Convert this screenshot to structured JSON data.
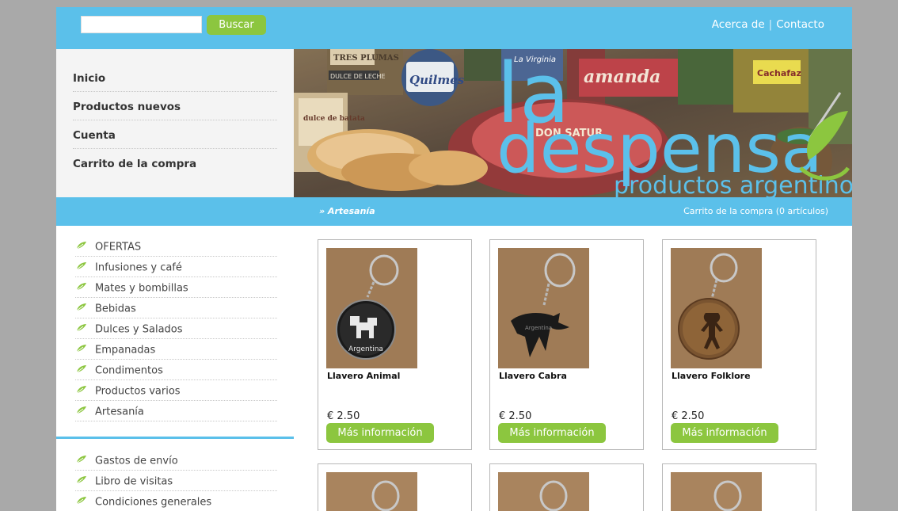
{
  "header": {
    "search": {
      "value": "",
      "placeholder": "",
      "button_label": "Buscar"
    },
    "links": [
      {
        "label": "Acerca de"
      },
      {
        "label": "Contacto"
      }
    ],
    "separator": "|"
  },
  "main_nav": {
    "items": [
      {
        "label": "Inicio"
      },
      {
        "label": "Productos nuevos"
      },
      {
        "label": "Cuenta"
      },
      {
        "label": "Carrito de la compra"
      }
    ]
  },
  "banner": {
    "logo_line1": "la",
    "logo_line2": "despensa",
    "logo_tagline": "productos argentinos",
    "package_texts": [
      "TRES PLUMAS",
      "DULCE DE LECHE",
      "Quilmes",
      "La Virginia",
      "amanda",
      "DON SATUR",
      "dulce de batata",
      "Cachafaz"
    ]
  },
  "subbar": {
    "breadcrumb": "» Artesanía",
    "cart_status": "Carrito de la compra (0 artículos)"
  },
  "sidebar": {
    "categories": [
      {
        "label": "OFERTAS"
      },
      {
        "label": "Infusiones y café"
      },
      {
        "label": "Mates y bombillas"
      },
      {
        "label": "Bebidas"
      },
      {
        "label": "Dulces y Salados"
      },
      {
        "label": "Empanadas"
      },
      {
        "label": "Condimentos"
      },
      {
        "label": "Productos varios"
      },
      {
        "label": "Artesanía"
      }
    ],
    "info_links": [
      {
        "label": "Gastos de envío"
      },
      {
        "label": "Libro de visitas"
      },
      {
        "label": "Condiciones generales"
      }
    ]
  },
  "products": [
    {
      "name": "Llavero Animal",
      "price": "€ 2.50",
      "button_label": "Más información",
      "tag_text": "Argentina"
    },
    {
      "name": "Llavero Cabra",
      "price": "€ 2.50",
      "button_label": "Más información",
      "tag_text": "Argentina"
    },
    {
      "name": "Llavero Folklore",
      "price": "€ 2.50",
      "button_label": "Más información"
    }
  ],
  "colors": {
    "accent_blue": "#5bc0ea",
    "accent_green": "#8cc63f",
    "page_bg": "#a9a9a9"
  },
  "icons": {
    "category_bullet": "leaf-icon"
  }
}
